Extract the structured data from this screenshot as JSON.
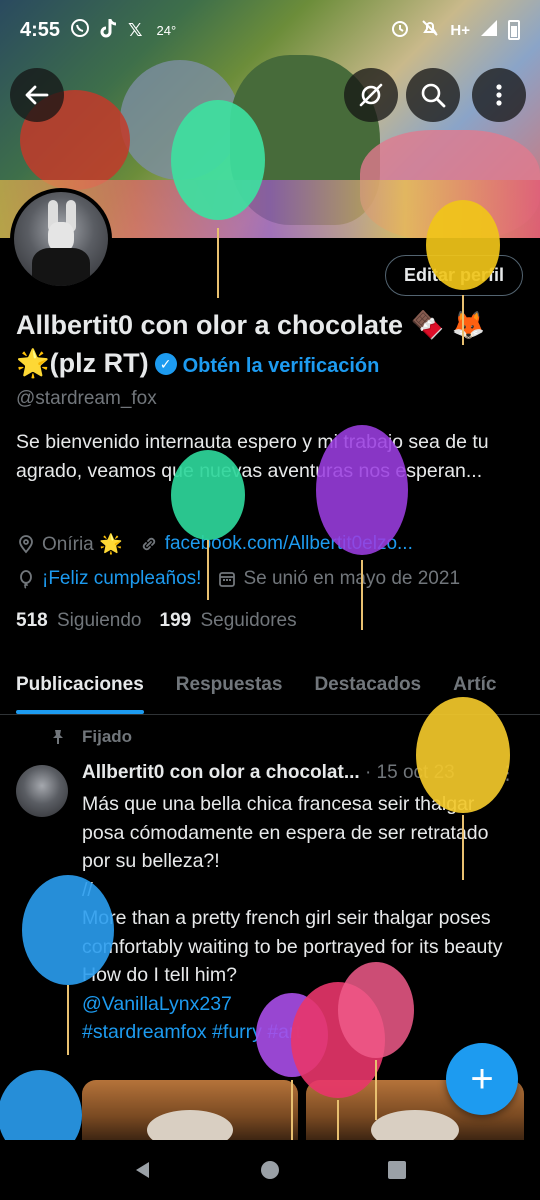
{
  "status_bar": {
    "time": "4:55",
    "temperature": "24°",
    "network": "H+"
  },
  "profile": {
    "edit_label": "Editar perfil",
    "display_name": "Allbertit0 con olor a chocolate 🍫 🦊 🌟(plz RT)",
    "verify_label": "Obtén la verificación",
    "handle": "@stardream_fox",
    "bio": "Se bienvenido internauta espero y mi trabajo sea de tu agrado, veamos que nuevas aventuras nos esperan...",
    "location": "Oníria 🌟",
    "website": "facebook.com/Allbertit0elzo...",
    "birthday": "¡Feliz cumpleaños!",
    "joined": "Se unió en mayo de 2021",
    "following_count": "518",
    "following_label": "Siguiendo",
    "followers_count": "199",
    "followers_label": "Seguidores"
  },
  "tabs": [
    {
      "label": "Publicaciones",
      "active": true
    },
    {
      "label": "Respuestas",
      "active": false
    },
    {
      "label": "Destacados",
      "active": false
    },
    {
      "label": "Artíc",
      "active": false
    }
  ],
  "post": {
    "pinned_label": "Fijado",
    "author": "Allbertit0 con olor a chocolat...",
    "date": "· 15 oct 23",
    "lines": [
      "Más que una bella chica francesa seir thalgar posa cómodamente  en espera de ser retratado por su belleza?!",
      "//",
      "More than a pretty french girl seir thalgar poses comfortably waiting to be portrayed for its beauty",
      "How do I tell him?"
    ],
    "mention": "@VanillaLynx237",
    "hashtags": "#stardreamfox  #furry #art"
  },
  "fab_label": "+",
  "colors": {
    "accent": "#1d9bf0",
    "muted": "#71767b",
    "text": "#e7e9ea",
    "background": "#000000"
  },
  "balloons": [
    {
      "color": "#3ee0a0"
    },
    {
      "color": "#f0c419"
    },
    {
      "color": "#9b3ee0"
    },
    {
      "color": "#2ed69a"
    },
    {
      "color": "#f2c82a"
    },
    {
      "color": "#2a9df0"
    },
    {
      "color": "#a84ee8"
    },
    {
      "color": "#e8356a"
    },
    {
      "color": "#f05a8a"
    }
  ]
}
